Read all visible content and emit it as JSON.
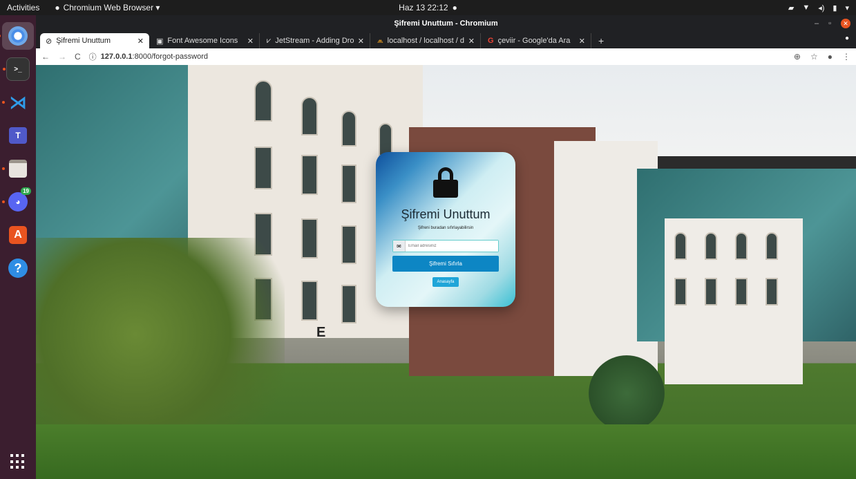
{
  "system": {
    "activities": "Activities",
    "app_menu": "Chromium Web Browser ▾",
    "clock": "Haz 13  22:12",
    "dock_badge": "19"
  },
  "window": {
    "title": "Şifremi Unuttum - Chromium"
  },
  "tabs": [
    {
      "label": "Şifremi Unuttum"
    },
    {
      "label": "Font Awesome Icons"
    },
    {
      "label": "JetStream - Adding Dropd"
    },
    {
      "label": "localhost / localhost / dem"
    },
    {
      "label": "çeviir - Google'da Ara"
    }
  ],
  "address": {
    "url_host": "127.0.0.1",
    "url_rest": ":8000/forgot-password"
  },
  "card": {
    "title": "Şifremi Unuttum",
    "subtitle": "Şifreni buradan sıfırlayabilirsin",
    "email_placeholder": "Email adresiniz",
    "reset_label": "Şifremi Sıfırla",
    "home_label": "Anasayfa"
  },
  "background": {
    "building_letter": "E"
  },
  "colors": {
    "primary_button": "#0d86c4",
    "home_button": "#1fa5d8",
    "dock": "#3b1e2f"
  }
}
